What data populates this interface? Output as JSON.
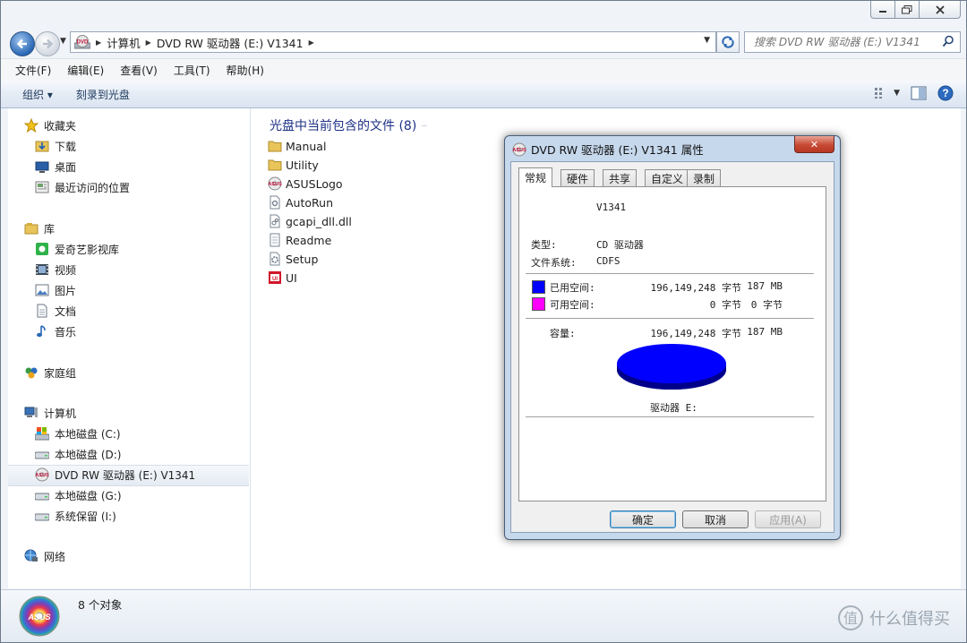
{
  "window": {
    "breadcrumb": [
      "计算机",
      "DVD RW 驱动器 (E:) V1341"
    ],
    "search_placeholder": "搜索 DVD RW 驱动器 (E:) V1341"
  },
  "menu": [
    "文件(F)",
    "编辑(E)",
    "查看(V)",
    "工具(T)",
    "帮助(H)"
  ],
  "toolbar": {
    "organize": "组织 ▾",
    "burn": "刻录到光盘"
  },
  "nav": {
    "favorites": {
      "title": "收藏夹",
      "items": [
        "下载",
        "桌面",
        "最近访问的位置"
      ]
    },
    "libraries": {
      "title": "库",
      "items": [
        "爱奇艺影视库",
        "视频",
        "图片",
        "文档",
        "音乐"
      ]
    },
    "homegroup": "家庭组",
    "computer": {
      "title": "计算机",
      "items": [
        "本地磁盘 (C:)",
        "本地磁盘 (D:)",
        "DVD RW 驱动器 (E:) V1341",
        "本地磁盘 (G:)",
        "系统保留 (I:)"
      ]
    },
    "network": "网络"
  },
  "files": {
    "group_header": "光盘中当前包含的文件 (8)",
    "items": [
      "Manual",
      "Utility",
      "ASUSLogo",
      "AutoRun",
      "gcapi_dll.dll",
      "Readme",
      "Setup",
      "UI"
    ]
  },
  "status": {
    "count": "8 个对象"
  },
  "watermark": "什么值得买",
  "dialog": {
    "title": "DVD RW 驱动器 (E:) V1341 属性",
    "close": "✕",
    "tabs": [
      "常规",
      "硬件",
      "共享",
      "自定义",
      "录制"
    ],
    "label": "V1341",
    "type_label": "类型:",
    "type_value": "CD 驱动器",
    "fs_label": "文件系统:",
    "fs_value": "CDFS",
    "used_label": "已用空间:",
    "used_bytes": "196,149,248 字节",
    "used_size": "187 MB",
    "free_label": "可用空间:",
    "free_bytes": "0 字节",
    "free_size": "0 字节",
    "cap_label": "容量:",
    "cap_bytes": "196,149,248 字节",
    "cap_size": "187 MB",
    "drive_label": "驱动器 E:",
    "used_color": "#0000ff",
    "free_color": "#ff00ff",
    "buttons": {
      "ok": "确定",
      "cancel": "取消",
      "apply": "应用(A)"
    }
  }
}
